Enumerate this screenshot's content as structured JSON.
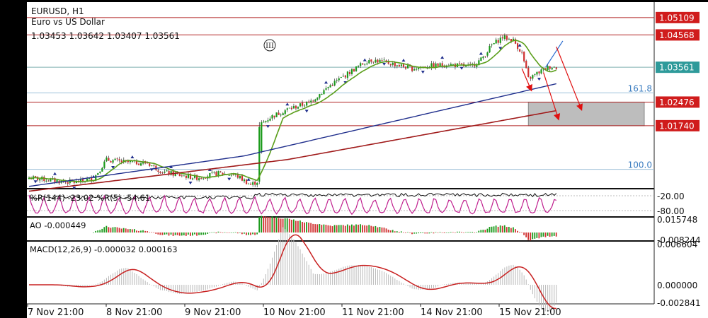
{
  "header": {
    "symbol": "EURUSD, H1",
    "description": "Euro vs US Dollar",
    "ohlc": "1.03453 1.03642 1.03407 1.03561"
  },
  "wave_label": "III",
  "price_levels": [
    {
      "value": 1.05109,
      "label": "1.05109",
      "kind": "resistance"
    },
    {
      "value": 1.04568,
      "label": "1.04568",
      "kind": "resistance"
    },
    {
      "value": 1.03561,
      "label": "1.03561",
      "kind": "current"
    },
    {
      "value": 1.02476,
      "label": "1.02476",
      "kind": "support"
    },
    {
      "value": 1.0174,
      "label": "1.01740",
      "kind": "support"
    }
  ],
  "fibo_levels": [
    {
      "label": "161.8",
      "value": 1.0276
    },
    {
      "label": "100.0",
      "value": 1.0038
    }
  ],
  "colors": {
    "bull": "#1a9a1a",
    "bear": "#d03030",
    "ma_fast": "#5a9e1a",
    "ma_mid": "#1f2e8c",
    "ma_slow": "#a01a1a",
    "level_line": "#b02020",
    "current_line": "#7fb0b0",
    "wpr": "#c0208f",
    "macd_signal": "#c82020",
    "macd_hist": "#b8b8b8"
  },
  "chart_data": [
    {
      "type": "candlestick",
      "panel": "price",
      "title": "EURUSD, H1",
      "ylim": [
        0.998,
        1.0559
      ],
      "x_ticks": [
        "7 Nov 21:00",
        "8 Nov 21:00",
        "9 Nov 21:00",
        "10 Nov 21:00",
        "11 Nov 21:00",
        "14 Nov 21:00",
        "15 Nov 21:00"
      ],
      "close_anchors": [
        [
          0,
          1.0012
        ],
        [
          8,
          1.0006
        ],
        [
          15,
          1.0
        ],
        [
          22,
          0.9998
        ],
        [
          30,
          1.001
        ],
        [
          36,
          1.0068
        ],
        [
          45,
          1.006
        ],
        [
          55,
          1.0058
        ],
        [
          62,
          1.003
        ],
        [
          70,
          1.002
        ],
        [
          78,
          1.0012
        ],
        [
          88,
          1.0026
        ],
        [
          96,
          1.002
        ],
        [
          103,
          0.999
        ],
        [
          106,
          1.0
        ],
        [
          108,
          1.018
        ],
        [
          112,
          1.02
        ],
        [
          120,
          1.0225
        ],
        [
          130,
          1.0245
        ],
        [
          140,
          1.03
        ],
        [
          150,
          1.0345
        ],
        [
          158,
          1.038
        ],
        [
          163,
          1.0375
        ],
        [
          170,
          1.0365
        ],
        [
          178,
          1.0352
        ],
        [
          186,
          1.036
        ],
        [
          195,
          1.0365
        ],
        [
          205,
          1.0358
        ],
        [
          210,
          1.038
        ],
        [
          215,
          1.0425
        ],
        [
          220,
          1.045
        ],
        [
          225,
          1.044
        ],
        [
          229,
          1.04
        ],
        [
          232,
          1.032
        ],
        [
          238,
          1.0345
        ],
        [
          242,
          1.0358
        ],
        [
          245,
          1.0356
        ]
      ],
      "trend_line": {
        "from": [
          240,
          1.0356
        ],
        "to": [
          248,
          1.0438
        ]
      },
      "sr_zone": {
        "from": 1.0174,
        "to": 1.02476,
        "x_start": 232
      }
    },
    {
      "type": "line",
      "panel": "wpr",
      "series": [
        {
          "name": "%R(144)",
          "last": -23.02
        },
        {
          "name": "%R(5)",
          "last": -54.61
        }
      ],
      "title": "%R(144) -23.02 %R(5) -54.61",
      "ylim": [
        -100,
        0
      ],
      "levels": [
        {
          "value": -20,
          "label": "-20.00"
        },
        {
          "value": -80,
          "label": "-80.00"
        }
      ]
    },
    {
      "type": "bar",
      "panel": "ao",
      "title": "AO -0.000449",
      "value": -0.000449,
      "ylim": [
        -0.008244,
        0.015748
      ],
      "y_ticks": [
        "0.015748",
        "-0.008244"
      ]
    },
    {
      "type": "bar",
      "panel": "macd",
      "title": "MACD(12,26,9) -0.000032 0.000163",
      "macd": -3.2e-05,
      "signal": 0.000163,
      "ylim": [
        -0.002841,
        0.006604
      ],
      "y_ticks": [
        "0.006604",
        "0.000000",
        "-0.002841"
      ]
    }
  ]
}
